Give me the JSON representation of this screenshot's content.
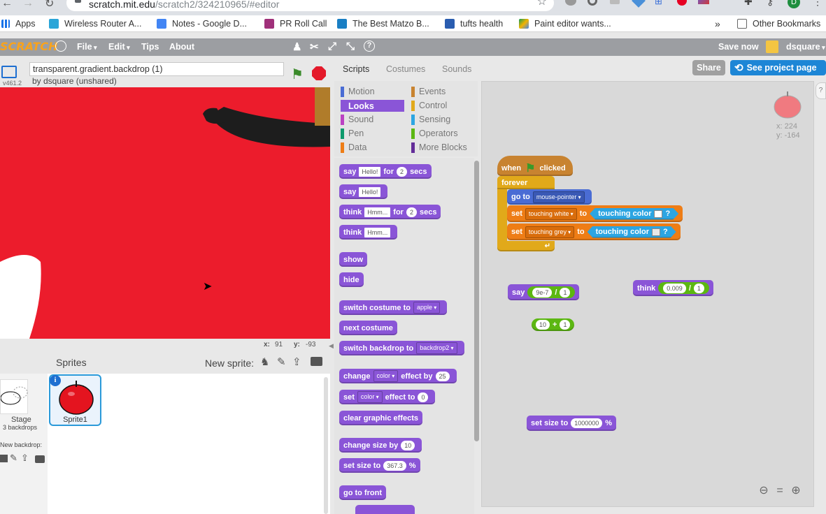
{
  "browser": {
    "url_host": "scratch.mit.edu",
    "url_path": "/scratch2/324210965/#editor",
    "bookmarks": [
      "Apps",
      "Wireless Router A...",
      "Notes - Google D...",
      "PR Roll Call",
      "The Best Matzo B...",
      "tufts health",
      "Paint editor wants..."
    ],
    "more": "»",
    "other_bookmarks": "Other Bookmarks",
    "profile_initial": "D"
  },
  "menubar": {
    "logo": "SCRATCH",
    "file": "File",
    "edit": "Edit",
    "tips": "Tips",
    "about": "About",
    "save_now": "Save now",
    "user": "dsquare"
  },
  "stage": {
    "version": "v461.2",
    "project_title": "transparent.gradient.backdrop (1)",
    "byline": "by dsquare (unshared)",
    "mouse_x_label": "x:",
    "mouse_x": "91",
    "mouse_y_label": "y:",
    "mouse_y": "-93"
  },
  "sprites": {
    "heading": "Sprites",
    "new_sprite": "New sprite:",
    "stage_label": "Stage",
    "stage_backdrops": "3 backdrops",
    "new_backdrop": "New backdrop:",
    "sprite1": "Sprite1"
  },
  "tabs": [
    "Scripts",
    "Costumes",
    "Sounds"
  ],
  "header_buttons": {
    "share": "Share",
    "project_page": "See project page"
  },
  "categories": {
    "left": [
      "Motion",
      "Looks",
      "Sound",
      "Pen",
      "Data"
    ],
    "right": [
      "Events",
      "Control",
      "Sensing",
      "Operators",
      "More Blocks"
    ],
    "selected": "Looks"
  },
  "palette": {
    "say_for": {
      "say": "say",
      "msg": "Hello!",
      "for": "for",
      "n": "2",
      "secs": "secs"
    },
    "say": {
      "say": "say",
      "msg": "Hello!"
    },
    "think_for": {
      "think": "think",
      "msg": "Hmm...",
      "for": "for",
      "n": "2",
      "secs": "secs"
    },
    "think": {
      "think": "think",
      "msg": "Hmm..."
    },
    "show": "show",
    "hide": "hide",
    "switch_costume": {
      "label": "switch costume to",
      "val": "apple"
    },
    "next_costume": "next costume",
    "switch_backdrop": {
      "label": "switch backdrop to",
      "val": "backdrop2"
    },
    "change_effect": {
      "change": "change",
      "effect": "color",
      "by": "effect by",
      "n": "25"
    },
    "set_effect": {
      "set": "set",
      "effect": "color",
      "to": "effect to",
      "n": "0"
    },
    "clear_effects": "clear graphic effects",
    "change_size": {
      "label": "change size by",
      "n": "10"
    },
    "set_size": {
      "label": "set size to",
      "n": "367.3",
      "pct": "%"
    },
    "go_front": "go to front"
  },
  "scripts": {
    "sprite_x": "x: 224",
    "sprite_y": "y: -164",
    "hat": {
      "when": "when",
      "clicked": "clicked"
    },
    "forever": "forever",
    "goto": {
      "label": "go to",
      "val": "mouse-pointer"
    },
    "set1": {
      "set": "set",
      "var": "touching white",
      "to": "to",
      "touching": "touching color",
      "q": "?"
    },
    "set2": {
      "set": "set",
      "var": "touching grey",
      "to": "to",
      "touching": "touching color",
      "q": "?"
    },
    "say_loose": {
      "say": "say",
      "a": "9e-7",
      "op": "/",
      "b": "1"
    },
    "think_loose": {
      "think": "think",
      "a": "0.009",
      "op": "/",
      "b": "1"
    },
    "add_loose": {
      "a": "10",
      "op": "+",
      "b": "1"
    },
    "setsize_loose": {
      "label": "set size to",
      "n": "1000000",
      "pct": "%"
    }
  },
  "colors": {
    "looks": "#8a55d7",
    "control": "#e1a91a",
    "events": "#c88330",
    "motion": "#4a6cd4",
    "sensing": "#2ca5e2",
    "variables": "#ee7d16",
    "operators": "#5cb712",
    "stage_bg": "#ec1c2c"
  }
}
